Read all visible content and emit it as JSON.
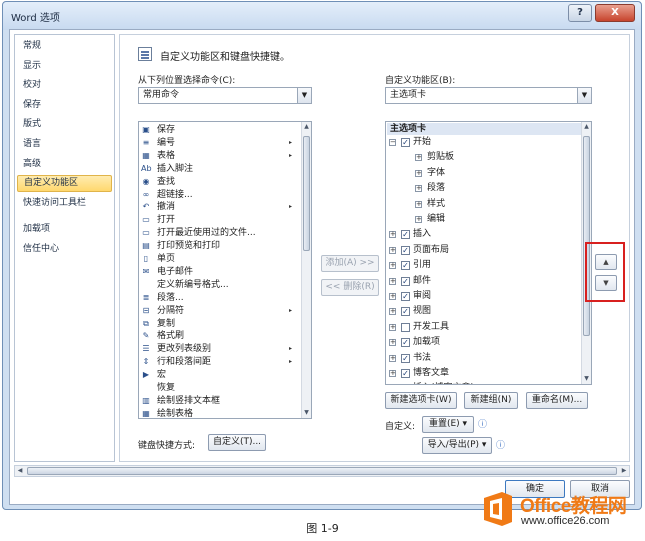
{
  "window": {
    "title": "Word 选项",
    "help": "?",
    "close": "X"
  },
  "nav": {
    "items": [
      "常规",
      "显示",
      "校对",
      "保存",
      "版式",
      "语言",
      "高级",
      "自定义功能区",
      "快速访问工具栏",
      "加载项",
      "信任中心"
    ],
    "selected_index": 7
  },
  "main": {
    "heading": "自定义功能区和键盘快捷键。",
    "left_label": "从下列位置选择命令(C):",
    "left_combo_value": "常用命令",
    "right_label": "自定义功能区(B):",
    "right_combo_value": "主选项卡",
    "commands": [
      {
        "icon": "save-icon",
        "glyph": "▣",
        "label": "保存",
        "sub": false
      },
      {
        "icon": "numbering-icon",
        "glyph": "≡",
        "label": "编号",
        "sub": true
      },
      {
        "icon": "table-icon",
        "glyph": "▦",
        "label": "表格",
        "sub": true
      },
      {
        "icon": "footnote-icon",
        "glyph": "Ab",
        "label": "插入脚注",
        "sub": false
      },
      {
        "icon": "find-icon",
        "glyph": "◉",
        "label": "查找",
        "sub": false
      },
      {
        "icon": "hyperlink-icon",
        "glyph": "∞",
        "label": "超链接...",
        "sub": false
      },
      {
        "icon": "undo-icon",
        "glyph": "↶",
        "label": "撤消",
        "sub": true
      },
      {
        "icon": "open-icon",
        "glyph": "▭",
        "label": "打开",
        "sub": false
      },
      {
        "icon": "open-recent-icon",
        "glyph": "▭",
        "label": "打开最近使用过的文件...",
        "sub": false
      },
      {
        "icon": "print-preview-icon",
        "glyph": "▤",
        "label": "打印预览和打印",
        "sub": false
      },
      {
        "icon": "page-icon",
        "glyph": "▯",
        "label": "单页",
        "sub": false
      },
      {
        "icon": "email-icon",
        "glyph": "✉",
        "label": "电子邮件",
        "sub": false
      },
      {
        "icon": "define-numbering-icon",
        "glyph": "",
        "label": "定义新编号格式...",
        "sub": false
      },
      {
        "icon": "paragraph-icon",
        "glyph": "≣",
        "label": "段落...",
        "sub": false
      },
      {
        "icon": "break-icon",
        "glyph": "⊟",
        "label": "分隔符",
        "sub": true
      },
      {
        "icon": "copy-icon",
        "glyph": "⧉",
        "label": "复制",
        "sub": false
      },
      {
        "icon": "format-painter-icon",
        "glyph": "✎",
        "label": "格式刷",
        "sub": false
      },
      {
        "icon": "list-level-icon",
        "glyph": "☰",
        "label": "更改列表级别",
        "sub": true
      },
      {
        "icon": "line-spacing-icon",
        "glyph": "⇕",
        "label": "行和段落间距",
        "sub": true
      },
      {
        "icon": "macro-icon",
        "glyph": "▶",
        "label": "宏",
        "sub": false
      },
      {
        "icon": "redo-icon",
        "glyph": "",
        "label": "恢复",
        "sub": false
      },
      {
        "icon": "textbox-icon",
        "glyph": "▥",
        "label": "绘制竖排文本框",
        "sub": false
      },
      {
        "icon": "draw-table-icon",
        "glyph": "▦",
        "label": "绘制表格",
        "sub": false
      }
    ],
    "add_button": "添加(A) >>",
    "remove_button": "<< 删除(R)",
    "tree": {
      "header": "主选项卡",
      "rows": [
        {
          "level": 0,
          "expander": "⊟",
          "checked": true,
          "label": "开始"
        },
        {
          "level": 1,
          "expander": "⊞",
          "checked": null,
          "label": "剪贴板"
        },
        {
          "level": 1,
          "expander": "⊞",
          "checked": null,
          "label": "字体"
        },
        {
          "level": 1,
          "expander": "⊞",
          "checked": null,
          "label": "段落"
        },
        {
          "level": 1,
          "expander": "⊞",
          "checked": null,
          "label": "样式"
        },
        {
          "level": 1,
          "expander": "⊞",
          "checked": null,
          "label": "编辑"
        },
        {
          "level": 0,
          "expander": "⊞",
          "checked": true,
          "label": "插入"
        },
        {
          "level": 0,
          "expander": "⊞",
          "checked": true,
          "label": "页面布局"
        },
        {
          "level": 0,
          "expander": "⊞",
          "checked": true,
          "label": "引用"
        },
        {
          "level": 0,
          "expander": "⊞",
          "checked": true,
          "label": "邮件"
        },
        {
          "level": 0,
          "expander": "⊞",
          "checked": true,
          "label": "审阅"
        },
        {
          "level": 0,
          "expander": "⊞",
          "checked": true,
          "label": "视图"
        },
        {
          "level": 0,
          "expander": "⊞",
          "checked": false,
          "label": "开发工具"
        },
        {
          "level": 0,
          "expander": "⊞",
          "checked": true,
          "label": "加载项"
        },
        {
          "level": 0,
          "expander": "⊞",
          "checked": true,
          "label": "书法"
        },
        {
          "level": 0,
          "expander": "⊞",
          "checked": true,
          "label": "博客文章"
        },
        {
          "level": 0,
          "expander": "⊞",
          "checked": true,
          "label": "插入(博客文章)"
        }
      ]
    },
    "new_tab_button": "新建选项卡(W)",
    "new_group_button": "新建组(N)",
    "rename_button": "重命名(M)...",
    "customize_label": "自定义:",
    "reset_button": "重置(E) ▾",
    "import_export_button": "导入/导出(P) ▾",
    "info_glyph": "ⓘ",
    "keyboard_label": "键盘快捷方式:",
    "keyboard_button": "自定义(T)..."
  },
  "move_up_glyph": "▲",
  "move_down_glyph": "▼",
  "footer": {
    "ok": "确定",
    "cancel": "取消"
  },
  "watermark": {
    "brand": "Office教程网",
    "url": "www.office26.com"
  },
  "caption": "图 1-9",
  "colors": {
    "selection": "#ffd86e",
    "highlight_box": "#d8201f",
    "watermark": "#f07a16"
  }
}
